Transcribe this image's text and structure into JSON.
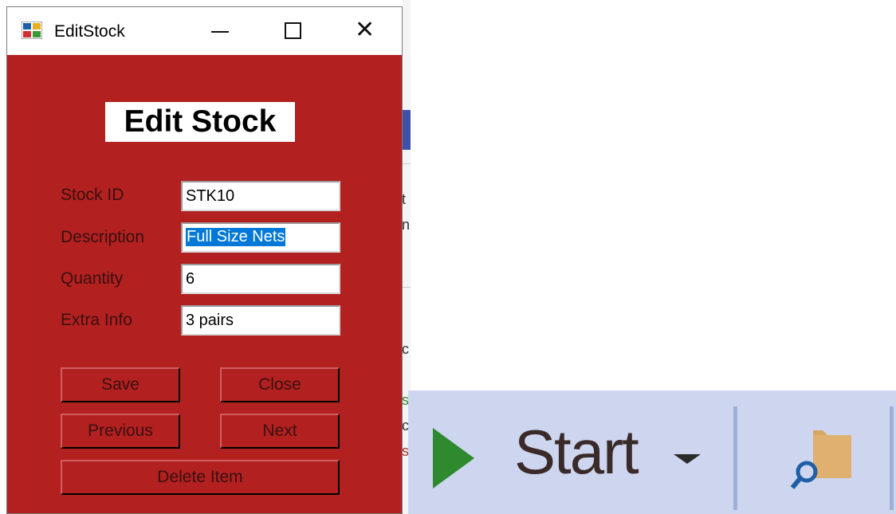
{
  "window": {
    "title": "EditStock",
    "controls": [
      "minimize",
      "maximize",
      "close"
    ]
  },
  "form": {
    "heading": "Edit Stock",
    "fields": [
      {
        "label": "Stock ID",
        "value": "STK10"
      },
      {
        "label": "Description",
        "value": "Full Size Nets",
        "selected": true
      },
      {
        "label": "Quantity",
        "value": "6"
      },
      {
        "label": "Extra Info",
        "value": "3 pairs"
      }
    ],
    "buttons": {
      "save": "Save",
      "close": "Close",
      "previous": "Previous",
      "next": "Next",
      "delete": "Delete Item"
    }
  },
  "toolbar": {
    "start_label": "Start",
    "icons": [
      "play-icon",
      "dropdown-icon",
      "folder-search-icon"
    ]
  },
  "background_fragments": [
    "t",
    "n",
    "c",
    "s",
    "c",
    "s"
  ],
  "colors": {
    "form_background": "#b22020",
    "selection": "#0078d7",
    "toolbar_background": "#cdd6ee",
    "play_green": "#2f8a2f"
  }
}
